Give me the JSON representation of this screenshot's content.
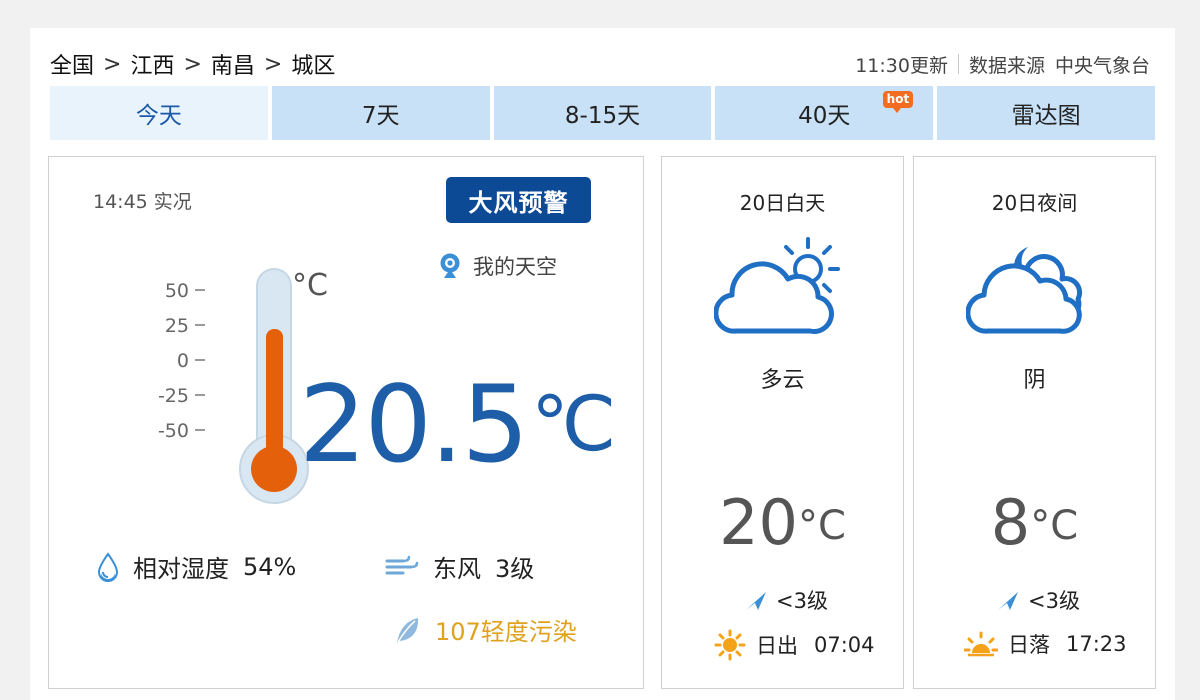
{
  "breadcrumb": {
    "items": [
      "全国",
      "江西",
      "南昌",
      "城区"
    ],
    "separator": ">"
  },
  "meta": {
    "updated": "11:30更新",
    "source_label": "数据来源",
    "source": "中央气象台"
  },
  "tabs": [
    {
      "label": "今天",
      "active": true
    },
    {
      "label": "7天"
    },
    {
      "label": "8-15天"
    },
    {
      "label": "40天",
      "badge": "hot"
    },
    {
      "label": "雷达图"
    }
  ],
  "now": {
    "obs_time": "14:45 实况",
    "alert": "大风预警",
    "mysky": "我的天空",
    "thermometer": {
      "unit": "°C",
      "scale": [
        "50",
        "25",
        "0",
        "-25",
        "-50"
      ]
    },
    "temp": "20.5",
    "temp_unit": "℃",
    "humidity_label": "相对湿度",
    "humidity": "54%",
    "wind_dir": "东风",
    "wind_level": "3级",
    "aqi": "107轻度污染"
  },
  "day": {
    "title": "20日白天",
    "weather": "多云",
    "temp": "20",
    "temp_unit": "°C",
    "wind": "<3级",
    "sun_label": "日出",
    "sun_time": "07:04"
  },
  "night": {
    "title": "20日夜间",
    "weather": "阴",
    "temp": "8",
    "temp_unit": "°C",
    "wind": "<3级",
    "sun_label": "日落",
    "sun_time": "17:23"
  },
  "colors": {
    "tab_bg": "#c8e1f6",
    "tab_active_bg": "#e8f3fc",
    "temp_blue": "#1e5ea8",
    "alert_bg": "#0c4a96",
    "aqi_color": "#e0a21e",
    "hot_badge": "#f26d21"
  },
  "icons": {
    "mysky": "webcam-icon",
    "humidity": "droplet-icon",
    "wind": "wind-icon",
    "aqi": "leaf-icon",
    "day_weather": "partly-cloudy-day-icon",
    "night_weather": "cloudy-night-icon",
    "forecast_wind": "wind-arrow-icon",
    "sunrise": "sunrise-icon",
    "sunset": "sunset-icon"
  }
}
